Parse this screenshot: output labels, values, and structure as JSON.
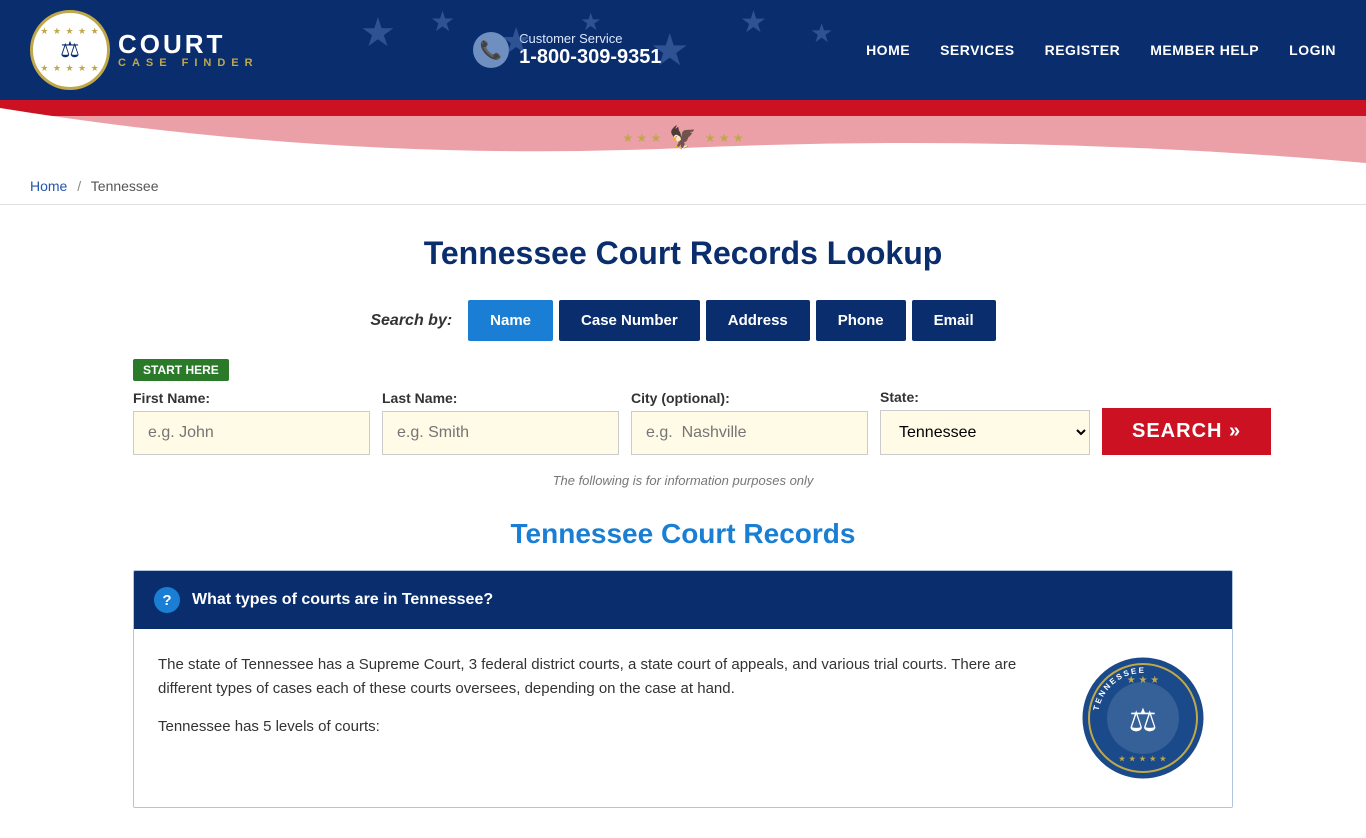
{
  "site": {
    "name": "Court Case Finder"
  },
  "header": {
    "logo_circle_star": "★ ★ ★ ★ ★",
    "logo_main": "COURT",
    "logo_sub": "CASE FINDER",
    "customer_service_label": "Customer Service",
    "customer_service_phone": "1-800-309-9351",
    "nav": [
      {
        "label": "HOME",
        "id": "home"
      },
      {
        "label": "SERVICES",
        "id": "services"
      },
      {
        "label": "REGISTER",
        "id": "register"
      },
      {
        "label": "MEMBER HELP",
        "id": "member-help"
      },
      {
        "label": "LOGIN",
        "id": "login"
      }
    ]
  },
  "breadcrumb": {
    "home_label": "Home",
    "current": "Tennessee"
  },
  "page": {
    "title": "Tennessee Court Records Lookup",
    "search_by_label": "Search by:",
    "tabs": [
      {
        "label": "Name",
        "id": "tab-name",
        "active": true
      },
      {
        "label": "Case Number",
        "id": "tab-case-number",
        "active": false
      },
      {
        "label": "Address",
        "id": "tab-address",
        "active": false
      },
      {
        "label": "Phone",
        "id": "tab-phone",
        "active": false
      },
      {
        "label": "Email",
        "id": "tab-email",
        "active": false
      }
    ],
    "start_here_badge": "START HERE",
    "form": {
      "first_name_label": "First Name:",
      "first_name_placeholder": "e.g. John",
      "last_name_label": "Last Name:",
      "last_name_placeholder": "e.g. Smith",
      "city_label": "City (optional):",
      "city_placeholder": "e.g.  Nashville",
      "state_label": "State:",
      "state_value": "Tennessee",
      "search_button": "SEARCH »"
    },
    "info_note": "The following is for information purposes only",
    "court_records_title": "Tennessee Court Records",
    "accordion": {
      "question_icon": "?",
      "question": "What types of courts are in Tennessee?",
      "para1": "The state of Tennessee has a Supreme Court, 3 federal district courts, a state court of appeals, and various trial courts. There are different types of cases each of these courts oversees, depending on the case at hand.",
      "para2": "Tennessee has 5 levels of courts:"
    }
  }
}
